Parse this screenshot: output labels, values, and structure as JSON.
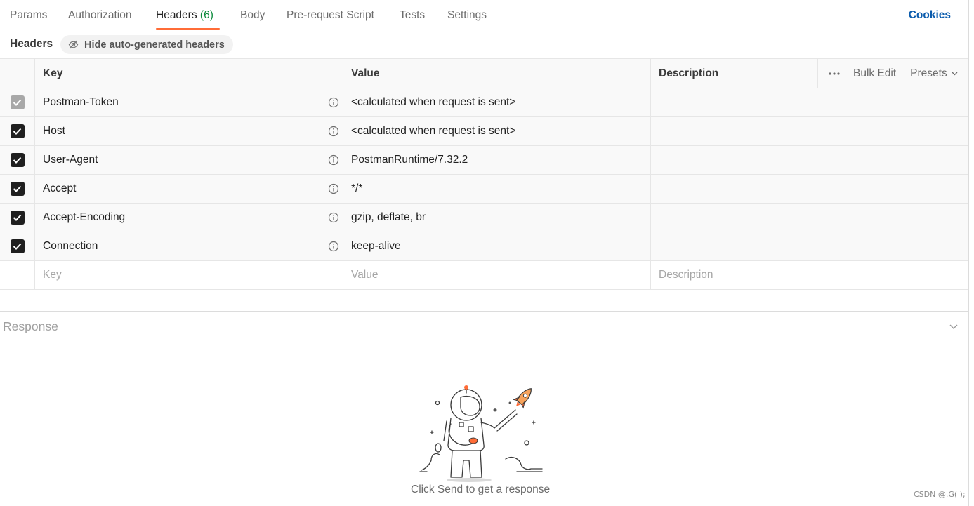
{
  "tabs": [
    {
      "label": "Params"
    },
    {
      "label": "Authorization"
    },
    {
      "label": "Headers",
      "count": "(6)"
    },
    {
      "label": "Body"
    },
    {
      "label": "Pre-request Script"
    },
    {
      "label": "Tests"
    },
    {
      "label": "Settings"
    }
  ],
  "active_tab": "Headers",
  "cookies_label": "Cookies",
  "section_title": "Headers",
  "hide_button_label": "Hide auto-generated headers",
  "table": {
    "columns": {
      "key": "Key",
      "value": "Value",
      "description": "Description"
    },
    "bulk_edit_label": "Bulk Edit",
    "presets_label": "Presets",
    "rows": [
      {
        "checked": true,
        "disabled": true,
        "key": "Postman-Token",
        "value": "<calculated when request is sent>",
        "description": ""
      },
      {
        "checked": true,
        "disabled": false,
        "key": "Host",
        "value": "<calculated when request is sent>",
        "description": ""
      },
      {
        "checked": true,
        "disabled": false,
        "key": "User-Agent",
        "value": "PostmanRuntime/7.32.2",
        "description": ""
      },
      {
        "checked": true,
        "disabled": false,
        "key": "Accept",
        "value": "*/*",
        "description": ""
      },
      {
        "checked": true,
        "disabled": false,
        "key": "Accept-Encoding",
        "value": "gzip, deflate, br",
        "description": ""
      },
      {
        "checked": true,
        "disabled": false,
        "key": "Connection",
        "value": "keep-alive",
        "description": ""
      }
    ],
    "new_row_placeholders": {
      "key": "Key",
      "value": "Value",
      "description": "Description"
    }
  },
  "response": {
    "title": "Response",
    "hint": "Click Send to get a response"
  },
  "watermark": "CSDN @.G( );",
  "colors": {
    "accent_orange": "#ff6c37",
    "link_blue": "#0b5cad",
    "count_green": "#0a8a3b",
    "checkbox_dark": "#1f1f1f"
  },
  "icons": [
    "eye-off-icon",
    "info-icon",
    "more-horizontal-icon",
    "chevron-down-icon",
    "check-icon",
    "astronaut-rocket-illustration"
  ]
}
